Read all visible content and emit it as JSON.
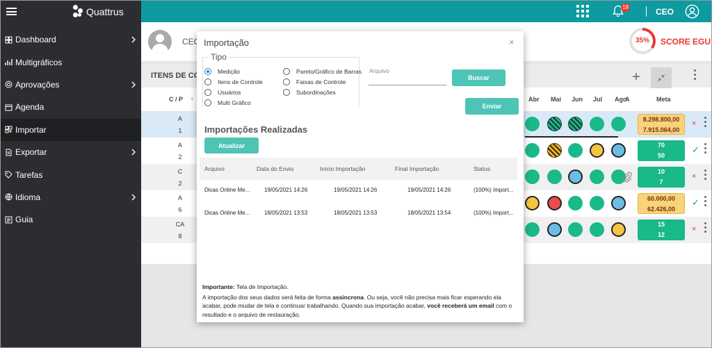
{
  "brand": {
    "name": "Quattrus"
  },
  "sidebar": {
    "items": [
      {
        "label": "Dashboard",
        "chevron": true,
        "icon": "dashboard-icon"
      },
      {
        "label": "Multigráficos",
        "chevron": false,
        "icon": "chart-icon"
      },
      {
        "label": "Aprovações",
        "chevron": true,
        "icon": "approval-icon"
      },
      {
        "label": "Agenda",
        "chevron": false,
        "icon": "calendar-icon"
      },
      {
        "label": "Importar",
        "chevron": false,
        "icon": "import-icon"
      },
      {
        "label": "Exportar",
        "chevron": true,
        "icon": "document-icon"
      },
      {
        "label": "Tarefas",
        "chevron": false,
        "icon": "tag-icon"
      },
      {
        "label": "Idioma",
        "chevron": true,
        "icon": "globe-icon"
      },
      {
        "label": "Guia",
        "chevron": false,
        "icon": "guide-icon"
      }
    ],
    "active": "Importar"
  },
  "header": {
    "notification_count": "19",
    "user": "CEO",
    "accent": "#0d9aa0"
  },
  "profile": {
    "name": "CEO",
    "score_percent": "35%",
    "score_fraction": 0.35,
    "score_label": "SCORE EGU"
  },
  "table": {
    "title": "ITENS DE CON",
    "columns": {
      "cp": "C / P",
      "months": [
        "Abr",
        "Mai",
        "Jun",
        "Jul",
        "Ago"
      ],
      "a": "A",
      "meta": "Meta"
    },
    "rows": [
      {
        "c": "A",
        "p": "1",
        "dots": [
          "g",
          "gs",
          "gs",
          "g",
          "g"
        ],
        "meta": [
          "8.298.800,00",
          "7.915.064,00"
        ],
        "meta_style": "yellow",
        "status": "×",
        "clip": false
      },
      {
        "c": "A",
        "p": "2",
        "dots": [
          "g",
          "ys",
          "g",
          "y",
          "b"
        ],
        "meta": [
          "70",
          "50"
        ],
        "meta_style": "green",
        "status": "✓",
        "clip": false
      },
      {
        "c": "C",
        "p": "2",
        "dots": [
          "g",
          "g",
          "b",
          "g",
          "g"
        ],
        "meta": [
          "10",
          "7"
        ],
        "meta_style": "green",
        "status": "×",
        "clip": true
      },
      {
        "c": "A",
        "p": "6",
        "dots": [
          "y",
          "r",
          "g",
          "g",
          "b"
        ],
        "meta": [
          "60.000,00",
          "62.426,00"
        ],
        "meta_style": "yellow",
        "status": "✓",
        "clip": false
      },
      {
        "c": "CA",
        "p": "8",
        "dots": [
          "g",
          "b",
          "g",
          "g",
          "y"
        ],
        "meta": [
          "15",
          "12"
        ],
        "meta_style": "green",
        "status": "×",
        "clip": false
      }
    ]
  },
  "modal": {
    "title": "Importação",
    "close": "×",
    "tipo_legend": "Tipo",
    "options_left": [
      "Medição",
      "Itens de Controle",
      "Usuários",
      "Multi Gráfico"
    ],
    "options_right": [
      "Pareto/Gráfico de Barras",
      "Faixas de Controle",
      "Subordinações"
    ],
    "selected": "Medição",
    "arquivo_label": "Arquivo",
    "arquivo_value": "",
    "buscar": "Buscar",
    "enviar": "Enviar",
    "realizadas_title": "Importações Realizadas",
    "atualizar": "Atualizar",
    "imp_columns": [
      "Arquivo",
      "Data do Envio",
      "Início Importação",
      "Final Importação",
      "Status"
    ],
    "imp_rows": [
      [
        "Dicas Online Me...",
        "19/05/2021 14:26",
        "19/05/2021 14:26",
        "19/05/2021 14:26",
        "(100%) Import..."
      ],
      [
        "Dicas Online Me...",
        "18/05/2021 13:53",
        "18/05/2021 13:53",
        "18/05/2021 13:54",
        "(100%) Import..."
      ]
    ],
    "note_label": "Importante:",
    "note_label_rest": " Tela de Importação.",
    "note_p1": "A importação dos seus dados será feita de forma ",
    "note_bold1": "assincrona",
    "note_p2": ". Ou seja, você não precisa mais ficar esperando ela acabar, pode mudar de tela e continuar trabalhando. Quando sua importação acabar, ",
    "note_bold2": "você receberá um email",
    "note_p3": " com o resultado e o arquivo de restauração."
  }
}
